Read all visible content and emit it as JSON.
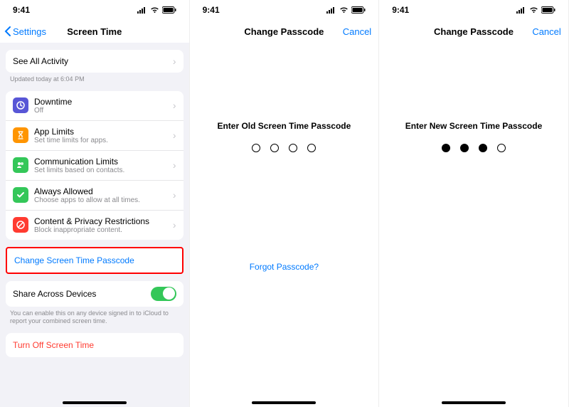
{
  "status": {
    "time": "9:41"
  },
  "phone1": {
    "back_label": "Settings",
    "title": "Screen Time",
    "see_all": "See All Activity",
    "updated": "Updated today at 6:04 PM",
    "rows": [
      {
        "title": "Downtime",
        "sub": "Off",
        "icon": "downtime-icon",
        "color": "#5856d6"
      },
      {
        "title": "App Limits",
        "sub": "Set time limits for apps.",
        "icon": "hourglass-icon",
        "color": "#ff9500"
      },
      {
        "title": "Communication Limits",
        "sub": "Set limits based on contacts.",
        "icon": "communication-icon",
        "color": "#34c759"
      },
      {
        "title": "Always Allowed",
        "sub": "Choose apps to allow at all times.",
        "icon": "check-icon",
        "color": "#34c759"
      },
      {
        "title": "Content & Privacy Restrictions",
        "sub": "Block inappropriate content.",
        "icon": "block-icon",
        "color": "#ff3b30"
      }
    ],
    "change_passcode": "Change Screen Time Passcode",
    "share_label": "Share Across Devices",
    "share_note": "You can enable this on any device signed in to iCloud to report your combined screen time.",
    "turn_off": "Turn Off Screen Time"
  },
  "phone2": {
    "title": "Change Passcode",
    "cancel": "Cancel",
    "prompt": "Enter Old Screen Time Passcode",
    "filled": 0,
    "forgot": "Forgot Passcode?"
  },
  "phone3": {
    "title": "Change Passcode",
    "cancel": "Cancel",
    "prompt": "Enter New Screen Time Passcode",
    "filled": 3
  }
}
